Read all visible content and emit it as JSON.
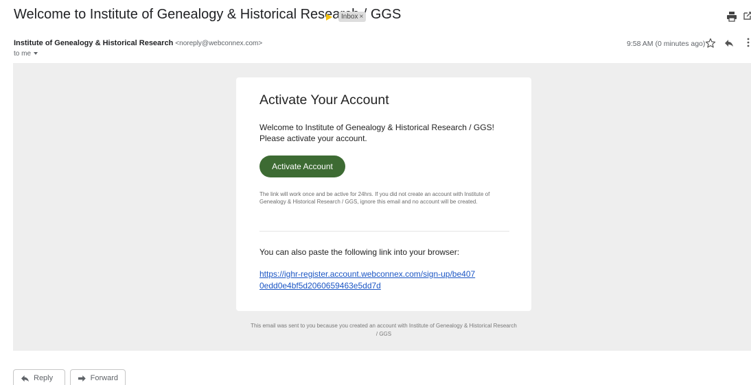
{
  "email": {
    "subject": "Welcome to Institute of Genealogy & Historical Research / GGS",
    "label_chip": "Inbox",
    "label_chip_close": "×",
    "sender_name": "Institute of Genealogy & Historical Research",
    "sender_email": "<noreply@webconnex.com>",
    "recipient": "to me",
    "timestamp": "9:58 AM (0 minutes ago)"
  },
  "message": {
    "title": "Activate Your Account",
    "welcome_line1": "Welcome to Institute of Genealogy & Historical Research / GGS!",
    "welcome_line2": "Please activate your account.",
    "activate_button": "Activate Account",
    "disclaimer": "The link will work once and be active for 24hrs. If you did not create an account with Institute of Genealogy & Historical Research / GGS, ignore this email and no account will be created.",
    "paste_instruction": "You can also paste the following link into your browser:",
    "link": "https://ighr-register.account.webconnex.com/sign-up/be4070edd0e4bf5d2060659463e5dd7d",
    "footer": "This email was sent to you because you created an account with Institute of Genealogy & Historical Research / GGS"
  },
  "actions": {
    "reply": "Reply",
    "forward": "Forward"
  },
  "icons": {
    "important": "important-marker-icon",
    "print": "print-icon",
    "popout": "popout-icon",
    "star": "star-icon",
    "reply": "reply-icon",
    "more": "more-vert-icon",
    "forward": "forward-icon"
  },
  "colors": {
    "button": "#3d6b33",
    "link": "#1a55c4",
    "important": "#f4c20d",
    "body_background": "#eeeeee"
  }
}
